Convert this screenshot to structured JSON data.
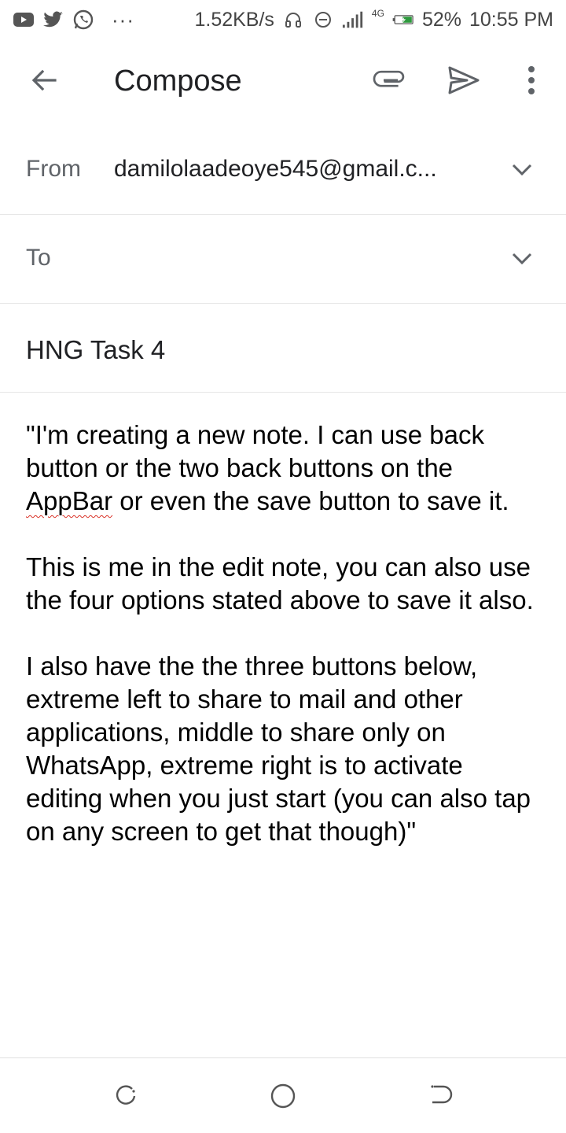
{
  "status_bar": {
    "speed": "1.52KB/s",
    "network": "4G",
    "battery": "52%",
    "time": "10:55 PM",
    "dots": "···",
    "icons": [
      "youtube-icon",
      "twitter-icon",
      "whatsapp-icon",
      "headphone-icon",
      "dnd-icon",
      "signal-icon",
      "battery-icon"
    ]
  },
  "app_bar": {
    "title": "Compose",
    "icons": [
      "back-arrow-icon",
      "attach-icon",
      "send-icon",
      "more-vert-icon"
    ]
  },
  "from": {
    "label": "From",
    "value": "damilolaadeoye545@gmail.c..."
  },
  "to": {
    "label": "To",
    "value": ""
  },
  "subject": {
    "value": "HNG Task 4"
  },
  "body": {
    "p1_before": "\"I'm creating a new note. I can use back button or the two back buttons on the ",
    "p1_misspelled": "AppBar",
    "p1_after": " or even the save button to save it.",
    "p2": "This is me in the edit note, you can also use the four options stated above to save it also.",
    "p3": "I also have the the three buttons below, extreme left to share to mail and other applications, middle to share only on WhatsApp, extreme right is to activate editing when you just start (you can also tap on any screen to get that though)\""
  },
  "nav_bar": {
    "icons": [
      "recent-apps-icon",
      "home-icon",
      "back-icon"
    ]
  },
  "colors": {
    "text_primary": "#202124",
    "text_secondary": "#5f6368",
    "divider": "#e6e6e6",
    "spellcheck": "#d93025"
  }
}
